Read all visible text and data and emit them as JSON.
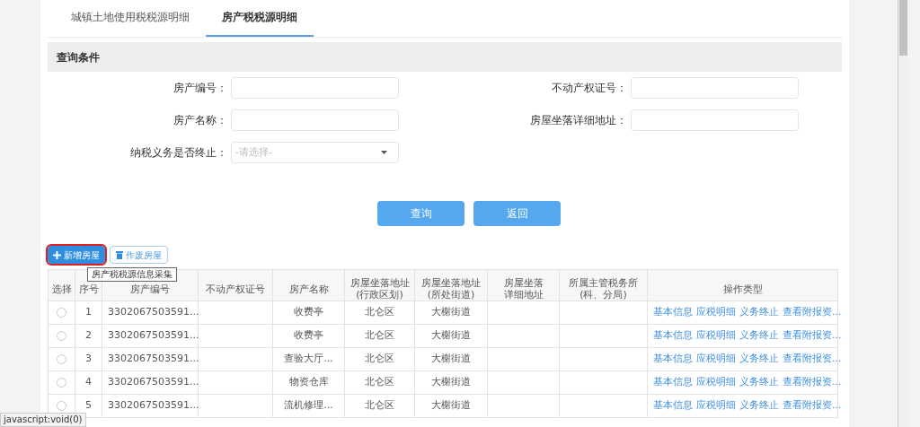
{
  "tabs": [
    {
      "label": "城镇土地使用税税源明细",
      "selected": false
    },
    {
      "label": "房产税税源明细",
      "selected": true
    }
  ],
  "query": {
    "title": "查询条件",
    "fields": [
      {
        "kind": "text",
        "label": "房产编号："
      },
      {
        "kind": "text",
        "label": "不动产权证号："
      },
      {
        "kind": "text",
        "label": "房产名称："
      },
      {
        "kind": "text",
        "label": "房屋坐落详细地址："
      },
      {
        "kind": "select",
        "label": "纳税义务是否终止：",
        "placeholder": "-请选择-"
      }
    ],
    "buttons": [
      "查询",
      "返回"
    ]
  },
  "toolbar": {
    "buttons": [
      {
        "kind": "add",
        "label": "新增房屋",
        "highlighted": true
      },
      {
        "kind": "delete",
        "label": "作废房屋",
        "highlighted": false
      }
    ],
    "tooltip": "房产税税源信息采集"
  },
  "table": {
    "columns": [
      [
        "选择"
      ],
      [
        "序号"
      ],
      [
        "房产编号"
      ],
      [
        "不动产权证号"
      ],
      [
        "房产名称"
      ],
      [
        "房屋坐落地址",
        "(行政区划)"
      ],
      [
        "房屋坐落地址",
        "(所处街道)"
      ],
      [
        "房屋坐落",
        "详细地址"
      ],
      [
        "所属主管税务所",
        "(科、分局)"
      ],
      [
        "操作类型"
      ]
    ],
    "rows": [
      {
        "selected": false,
        "no": "1",
        "code": "3302067503591...",
        "name": "收费亭",
        "district": "北仑区",
        "street": "大榭街道",
        "actions": [
          "基本信息",
          "应税明细",
          "义务终止",
          "查看附报资..."
        ]
      },
      {
        "selected": false,
        "no": "2",
        "code": "3302067503591...",
        "name": "收费亭",
        "district": "北仑区",
        "street": "大榭街道",
        "actions": [
          "基本信息",
          "应税明细",
          "义务终止",
          "查看附报资..."
        ]
      },
      {
        "selected": false,
        "no": "3",
        "code": "3302067503591...",
        "name": "查验大厅...",
        "district": "北仑区",
        "street": "大榭街道",
        "actions": [
          "基本信息",
          "应税明细",
          "义务终止",
          "查看附报资..."
        ]
      },
      {
        "selected": false,
        "no": "4",
        "code": "3302067503591...",
        "name": "物资仓库",
        "district": "北仑区",
        "street": "大榭街道",
        "actions": [
          "基本信息",
          "应税明细",
          "义务终止",
          "查看附报资..."
        ]
      },
      {
        "selected": false,
        "no": "5",
        "code": "3302067503591...",
        "name": "流机修理...",
        "district": "北仑区",
        "street": "大榭街道",
        "actions": [
          "基本信息",
          "应税明细",
          "义务终止",
          "查看附报资..."
        ]
      }
    ]
  },
  "status_bar": "javascript:void(0)"
}
